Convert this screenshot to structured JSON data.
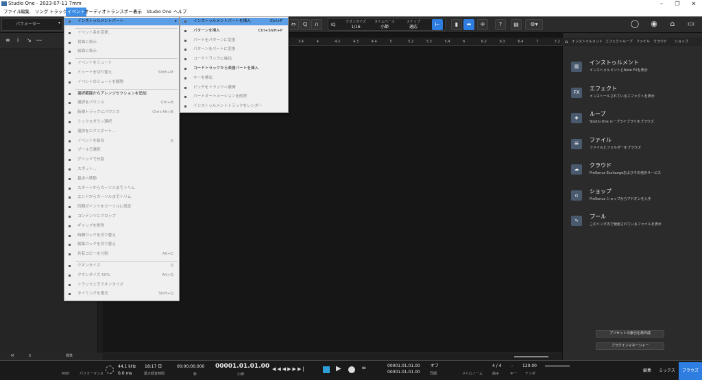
{
  "window": {
    "title": "Studio One - 2023-07-11 7mm",
    "minimize": "–",
    "maximize": "❐",
    "close": "✕"
  },
  "menubar": [
    {
      "label": "ファイル"
    },
    {
      "label": "編集"
    },
    {
      "label": "ソング"
    },
    {
      "label": "トラック"
    },
    {
      "label": "イベント",
      "active": true
    },
    {
      "label": "オーディオ"
    },
    {
      "label": "トランスポート"
    },
    {
      "label": "表示"
    },
    {
      "label": "Studio One"
    },
    {
      "label": "ヘルプ"
    }
  ],
  "toolbar": {
    "params_label": "パラメーター",
    "quantize_label": "クオンタイズ",
    "quantize_value": "1/16",
    "timebase_label": "タイムベース",
    "timebase_value": "小節",
    "snap_label": "スナップ",
    "snap_value": "適応",
    "iq": "IQ"
  },
  "event_menu": [
    {
      "icon": "instrument-part-icon",
      "label": "インストゥルメントパート",
      "submenu": true,
      "highlight": true
    },
    {
      "sep": true
    },
    {
      "icon": "rename-icon",
      "label": "イベント名を変更...",
      "disabled": true
    },
    {
      "icon": "front-icon",
      "label": "背面に表示",
      "disabled": true
    },
    {
      "icon": "back-icon",
      "label": "前面に表示",
      "disabled": true
    },
    {
      "sep": true
    },
    {
      "icon": "mute-icon",
      "label": "イベントをミュート",
      "disabled": true
    },
    {
      "icon": "mute-toggle-icon",
      "label": "ミュートを切り替え",
      "shortcut": "Shift+M",
      "disabled": true
    },
    {
      "icon": "unmute-icon",
      "label": "イベントのミュートを解除",
      "disabled": true
    },
    {
      "sep": true
    },
    {
      "icon": "arranger-icon",
      "label": "選択範囲からアレンジセクションを追加"
    },
    {
      "icon": "bounce-icon",
      "label": "選択をバウンス",
      "shortcut": "Ctrl+B",
      "disabled": true
    },
    {
      "icon": "bounce-new-icon",
      "label": "新規トラックにバウンス",
      "shortcut": "Ctrl+Alt+B",
      "disabled": true
    },
    {
      "icon": "mixdown-icon",
      "label": "ミックスダウン選択",
      "disabled": true
    },
    {
      "icon": "export-icon",
      "label": "選択をエクスポート...",
      "disabled": true
    },
    {
      "icon": "merge-icon",
      "label": "イベントを結合",
      "shortcut": "G",
      "disabled": true
    },
    {
      "icon": "pool-icon",
      "label": "プールで選択",
      "disabled": true
    },
    {
      "icon": "grid-split-icon",
      "label": "グリッドで分割",
      "disabled": true
    },
    {
      "icon": "spot-icon",
      "label": "スポット...",
      "disabled": true
    },
    {
      "icon": "origin-icon",
      "label": "基点へ移動",
      "disabled": true
    },
    {
      "icon": "trim-start-icon",
      "label": "スタートからカーソルまでトリム",
      "disabled": true
    },
    {
      "icon": "trim-end-icon",
      "label": "エンドからカーソルまでトリム",
      "disabled": true
    },
    {
      "icon": "sync-point-icon",
      "label": "同期ポイントをカーソルに設定",
      "disabled": true
    },
    {
      "icon": "crop-icon",
      "label": "コンテンツにクロップ",
      "disabled": true
    },
    {
      "icon": "gap-icon",
      "label": "ギャップを削除",
      "disabled": true
    },
    {
      "icon": "time-lock-icon",
      "label": "時間ロックを切り替え",
      "disabled": true
    },
    {
      "icon": "edit-lock-icon",
      "label": "編集ロックを切り替え",
      "disabled": true
    },
    {
      "icon": "shared-copy-icon",
      "label": "共有コピーを分割",
      "shortcut": "Alt+C",
      "disabled": true
    },
    {
      "sep": true
    },
    {
      "icon": "quantize-icon",
      "label": "クオンタイズ",
      "shortcut": "Q",
      "disabled": true
    },
    {
      "icon": "quantize50-icon",
      "label": "クオンタイズ 50%",
      "shortcut": "Alt+Q",
      "disabled": true
    },
    {
      "icon": "track-quantize-icon",
      "label": "トラック上でクオンタイズ",
      "disabled": true
    },
    {
      "icon": "timing-restore-icon",
      "label": "タイミングを復元",
      "shortcut": "Shift+Q",
      "disabled": true
    }
  ],
  "instrument_submenu": [
    {
      "icon": "keyboard-icon",
      "label": "インストゥルメントパートを挿入",
      "shortcut": "Ctrl+P",
      "highlight": true
    },
    {
      "icon": "pattern-icon",
      "label": "パターンを挿入",
      "shortcut": "Ctrl+Shift+P"
    },
    {
      "icon": "part-to-pattern-icon",
      "label": "パートをパターンに変換",
      "disabled": true
    },
    {
      "icon": "pattern-to-part-icon",
      "label": "パターンをパートに変換",
      "disabled": true
    },
    {
      "icon": "chord-extract-icon",
      "label": "コードトラックに抽出",
      "disabled": true
    },
    {
      "icon": "chord-insert-icon",
      "label": "コードトラックから楽器パートを挿入"
    },
    {
      "icon": "key-detect-icon",
      "label": "キーを検出",
      "disabled": true
    },
    {
      "icon": "pitch-expand-icon",
      "label": "ピッチをトラックへ展開",
      "disabled": true
    },
    {
      "icon": "automation-delete-icon",
      "label": "パートオートメーションを削除",
      "disabled": true
    },
    {
      "icon": "render-icon",
      "label": "インストゥルメントトラックをレンダー",
      "disabled": true
    }
  ],
  "ruler_ticks": [
    "3.4",
    "4",
    "4.2",
    "4.3",
    "4.4",
    "5",
    "5.2",
    "5.3",
    "5.4",
    "6",
    "6.2",
    "6.3",
    "6.4",
    "7",
    "7.2"
  ],
  "browser": {
    "tabs": [
      "インストゥルメント",
      "エフェクト",
      "ループ",
      "ファイル",
      "クラウド",
      "ショップ"
    ],
    "items": [
      {
        "icon": "piano-icon",
        "title": "インストゥルメント",
        "desc": "インストゥルメントとNote FXを表示"
      },
      {
        "icon": "fx-icon",
        "title": "エフェクト",
        "desc": "インストールされているエフェクトを表示"
      },
      {
        "icon": "loop-icon",
        "title": "ループ",
        "desc": "Studio One ループライブラリをブラウズ"
      },
      {
        "icon": "file-icon",
        "title": "ファイル",
        "desc": "ファイルとフォルダーをブラウズ"
      },
      {
        "icon": "cloud-icon",
        "title": "クラウド",
        "desc": "PreSonus Exchangeおよびその他のサービス"
      },
      {
        "icon": "shop-icon",
        "title": "ショップ",
        "desc": "PreSonus ショップからアドオンを入手"
      },
      {
        "icon": "pool-icon",
        "title": "プール",
        "desc": "このソング内で使用されているファイルを表示"
      }
    ],
    "reindex_button": "プリセットの索引を再作成",
    "plugin_manager_button": "プラグインマネージャー"
  },
  "left_footer": {
    "m": "M",
    "s": "S",
    "std": "標準"
  },
  "transport": {
    "midi": "MIDI",
    "perf": "パフォーマンス",
    "sample_rate": "44.1 kHz",
    "latency": "0.0 ms",
    "rec_time": "18:17 日",
    "rec_max": "最大録音時間",
    "time_sec": "00:00:00.000",
    "time_sec_unit": "秒",
    "bars": "00001.01.01.00",
    "bars_unit": "小節",
    "L": "00001.01.01.00",
    "R": "00001.01.01.00",
    "loop_off": "オフ",
    "sync": "同期",
    "metronome": "メトロノーム",
    "time_sig": "4 / 4",
    "time_sig_label": "拍子",
    "key": "-",
    "key_label": "キー",
    "tempo": "120.00",
    "tempo_label": "テンポ"
  },
  "bottom_tabs": [
    "編集",
    "ミックス",
    "ブラウズ"
  ]
}
